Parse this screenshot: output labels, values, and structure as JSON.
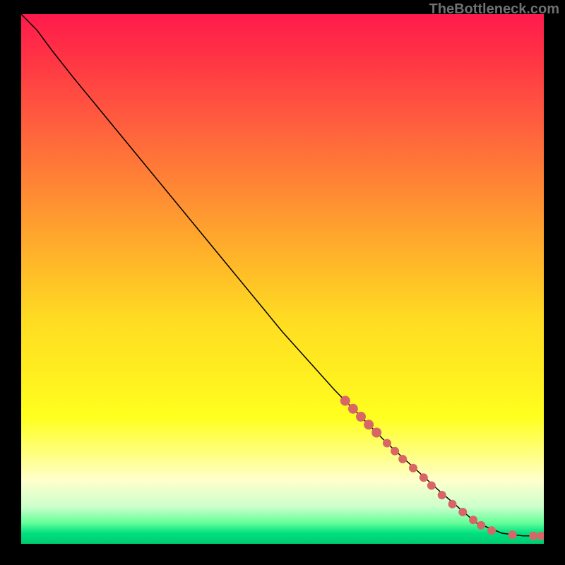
{
  "watermark": "TheBottleneck.com",
  "chart_data": {
    "type": "line",
    "title": "",
    "xlabel": "",
    "ylabel": "",
    "xlim": [
      0,
      100
    ],
    "ylim": [
      0,
      100
    ],
    "curve": [
      {
        "x": 0,
        "y": 100
      },
      {
        "x": 3,
        "y": 97
      },
      {
        "x": 6,
        "y": 93
      },
      {
        "x": 10,
        "y": 88
      },
      {
        "x": 15,
        "y": 82
      },
      {
        "x": 20,
        "y": 76
      },
      {
        "x": 30,
        "y": 64
      },
      {
        "x": 40,
        "y": 52
      },
      {
        "x": 50,
        "y": 40
      },
      {
        "x": 60,
        "y": 29
      },
      {
        "x": 70,
        "y": 19
      },
      {
        "x": 80,
        "y": 10
      },
      {
        "x": 87,
        "y": 4
      },
      {
        "x": 92,
        "y": 2
      },
      {
        "x": 96,
        "y": 1.5
      },
      {
        "x": 100,
        "y": 1.5
      }
    ],
    "scatter_points": [
      {
        "x": 62,
        "y": 27,
        "r": 7
      },
      {
        "x": 63.5,
        "y": 25.5,
        "r": 7
      },
      {
        "x": 65,
        "y": 24,
        "r": 7
      },
      {
        "x": 66.5,
        "y": 22.5,
        "r": 7
      },
      {
        "x": 68,
        "y": 21,
        "r": 7
      },
      {
        "x": 70,
        "y": 19,
        "r": 6
      },
      {
        "x": 71.5,
        "y": 17.5,
        "r": 6
      },
      {
        "x": 73,
        "y": 16,
        "r": 6
      },
      {
        "x": 75,
        "y": 14.3,
        "r": 6
      },
      {
        "x": 77,
        "y": 12.5,
        "r": 6
      },
      {
        "x": 78.5,
        "y": 11,
        "r": 6
      },
      {
        "x": 80.5,
        "y": 9.2,
        "r": 6
      },
      {
        "x": 82.5,
        "y": 7.5,
        "r": 6
      },
      {
        "x": 84.5,
        "y": 6,
        "r": 6
      },
      {
        "x": 86.5,
        "y": 4.5,
        "r": 6
      },
      {
        "x": 88,
        "y": 3.5,
        "r": 6
      },
      {
        "x": 90,
        "y": 2.5,
        "r": 6
      },
      {
        "x": 94,
        "y": 1.7,
        "r": 6
      },
      {
        "x": 98,
        "y": 1.5,
        "r": 6
      },
      {
        "x": 99.5,
        "y": 1.5,
        "r": 6
      }
    ]
  }
}
